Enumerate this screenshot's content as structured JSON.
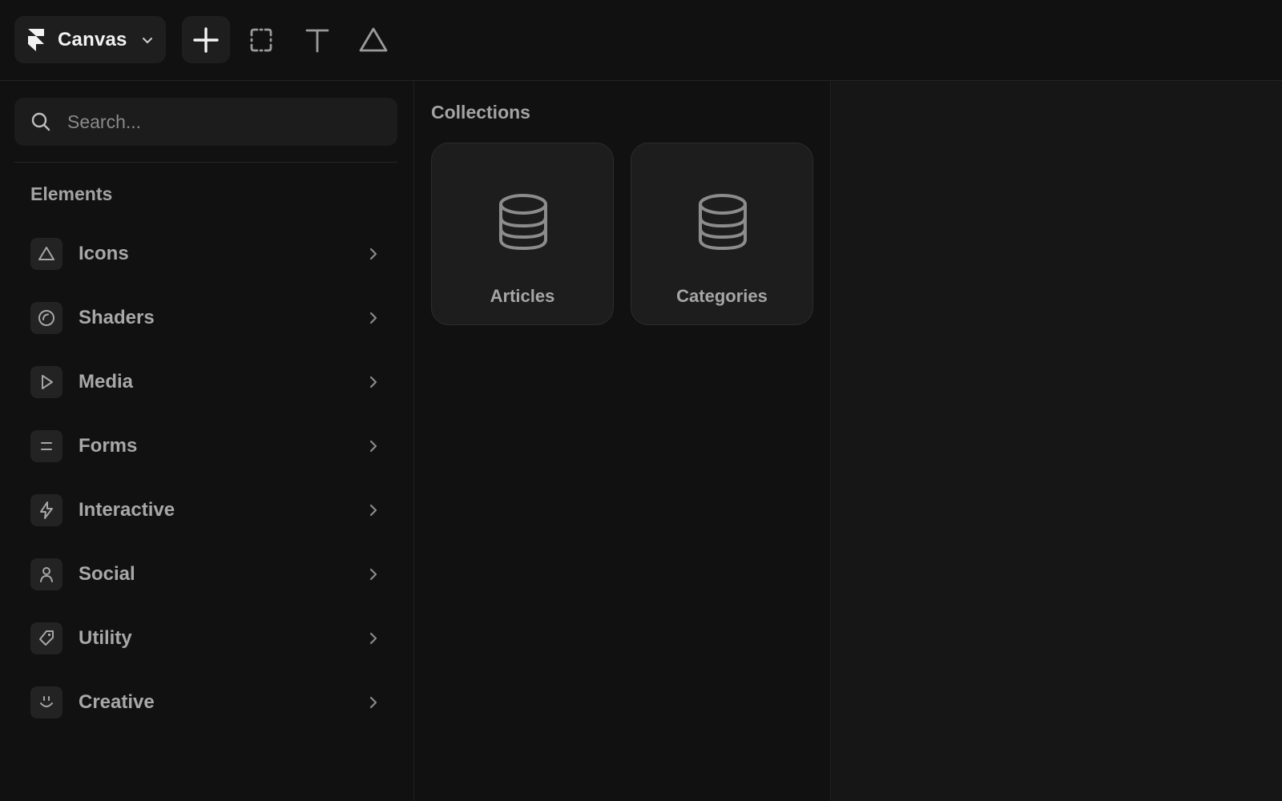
{
  "topbar": {
    "project_name": "Canvas",
    "tools": [
      "insert",
      "frame",
      "text",
      "vector"
    ]
  },
  "sidebar": {
    "search": {
      "placeholder": "Search...",
      "value": ""
    },
    "section_title": "Elements",
    "items": [
      {
        "label": "Icons",
        "icon": "triangle-icon"
      },
      {
        "label": "Shaders",
        "icon": "shader-circle-icon"
      },
      {
        "label": "Media",
        "icon": "play-icon"
      },
      {
        "label": "Forms",
        "icon": "form-lines-icon"
      },
      {
        "label": "Interactive",
        "icon": "bolt-icon"
      },
      {
        "label": "Social",
        "icon": "person-icon"
      },
      {
        "label": "Utility",
        "icon": "tag-icon"
      },
      {
        "label": "Creative",
        "icon": "smile-icon"
      }
    ]
  },
  "collections": {
    "title": "Collections",
    "items": [
      {
        "label": "Articles",
        "icon": "database-icon"
      },
      {
        "label": "Categories",
        "icon": "database-icon"
      }
    ]
  },
  "colors": {
    "background": "#111111",
    "panel": "#1e1e1e",
    "text_primary": "#f2f2f2",
    "text_secondary": "#a8a8a8"
  }
}
